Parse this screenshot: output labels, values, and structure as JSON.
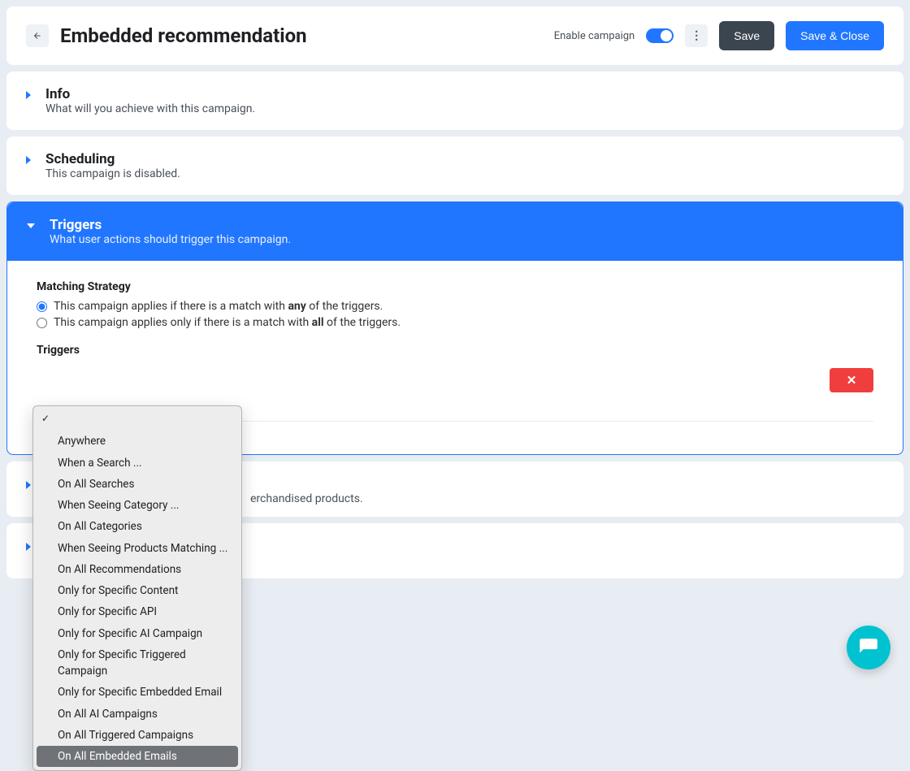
{
  "header": {
    "title": "Embedded recommendation",
    "enable_label": "Enable campaign",
    "save_label": "Save",
    "save_close_label": "Save & Close",
    "more_glyph": "⋮"
  },
  "sections": {
    "info": {
      "title": "Info",
      "sub": "What will you achieve with this campaign."
    },
    "scheduling": {
      "title": "Scheduling",
      "sub": "This campaign is disabled."
    },
    "triggers": {
      "title": "Triggers",
      "sub": "What user actions should trigger this campaign."
    },
    "merchandising_sub_tail": "erchandised products."
  },
  "matching": {
    "label": "Matching Strategy",
    "opt_any_pre": "This campaign applies if there is a match with ",
    "opt_any_bold": "any",
    "opt_any_post": " of the triggers.",
    "opt_all_pre": "This campaign applies only if there is a match with ",
    "opt_all_bold": "all",
    "opt_all_post": " of the triggers."
  },
  "triggers_block": {
    "label": "Triggers",
    "remove_glyph": "✕"
  },
  "dropdown": {
    "items": [
      "Anywhere",
      "When a Search ...",
      "On All Searches",
      "When Seeing Category ...",
      "On All Categories",
      "When Seeing Products Matching ...",
      "On All Recommendations",
      "Only for Specific Content",
      "Only for Specific API",
      "Only for Specific AI Campaign",
      "Only for Specific Triggered Campaign",
      "Only for Specific Embedded Email",
      "On All AI Campaigns",
      "On All Triggered Campaigns",
      "On All Embedded Emails"
    ],
    "highlight_index": 14
  }
}
